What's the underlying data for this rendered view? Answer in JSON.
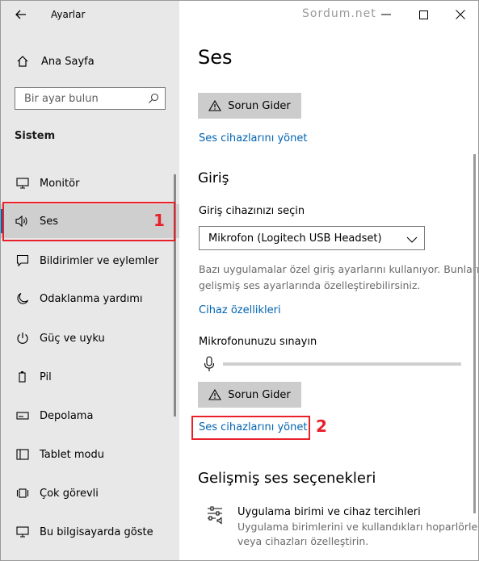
{
  "window": {
    "app_title": "Ayarlar",
    "watermark": "Sordum.net"
  },
  "sidebar": {
    "home_label": "Ana Sayfa",
    "search_placeholder": "Bir ayar bulun",
    "section_title": "Sistem",
    "items": [
      {
        "label": "Monitör",
        "icon": "monitor-icon"
      },
      {
        "label": "Ses",
        "icon": "speaker-icon",
        "selected": true
      },
      {
        "label": "Bildirimler ve eylemler",
        "icon": "notification-icon"
      },
      {
        "label": "Odaklanma yardımı",
        "icon": "moon-icon"
      },
      {
        "label": "Güç ve uyku",
        "icon": "power-icon"
      },
      {
        "label": "Pil",
        "icon": "battery-icon"
      },
      {
        "label": "Depolama",
        "icon": "storage-icon"
      },
      {
        "label": "Tablet modu",
        "icon": "tablet-icon"
      },
      {
        "label": "Çok görevli",
        "icon": "multitask-icon"
      },
      {
        "label": "Bu bilgisayarda göste",
        "icon": "project-icon"
      }
    ]
  },
  "annotations": {
    "marker_1": "1",
    "marker_2": "2",
    "accent_color": "#e8202a"
  },
  "main": {
    "page_title": "Ses",
    "output": {
      "troubleshoot_label": "Sorun Gider",
      "manage_devices_link": "Ses cihazlarını yönet"
    },
    "input": {
      "heading": "Giriş",
      "choose_label": "Giriş cihazınızı seçin",
      "device_value": "Mikrofon (Logitech USB Headset)",
      "info_line1": "Bazı uygulamalar özel giriş ayarlarını kullanıyor. Bunları",
      "info_line2": "gelişmiş ses ayarlarında özelleştirebilirsiniz.",
      "device_props_link": "Cihaz özellikleri",
      "test_label": "Mikrofonunuzu sınayın",
      "troubleshoot_label": "Sorun Gider",
      "manage_devices_link": "Ses cihazlarını yönet"
    },
    "advanced": {
      "heading": "Gelişmiş ses seçenekleri",
      "app_pref_title": "Uygulama birimi ve cihaz tercihleri",
      "app_pref_desc1": "Uygulama birimlerini ve kullandıkları hoparlörleri",
      "app_pref_desc2": "veya cihazları özelleştirin."
    },
    "link_color": "#0063b1"
  }
}
